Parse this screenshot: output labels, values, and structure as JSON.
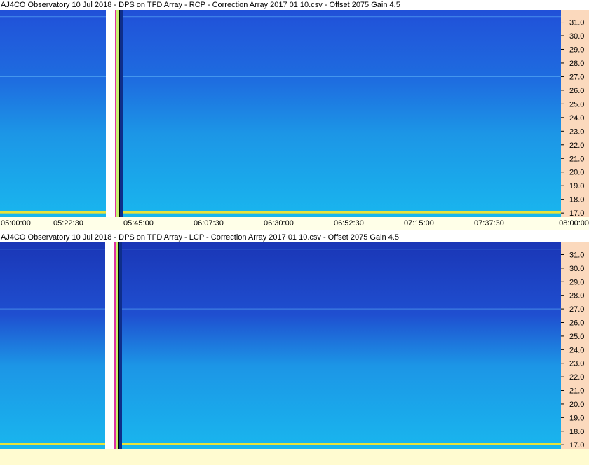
{
  "panels": [
    {
      "title": "AJ4CO Observatory 10 Jul 2018  -  DPS on TFD Array  -  RCP  -  Correction Array 2017 01 10.csv  -  Offset 2075  Gain 4.5"
    },
    {
      "title": "AJ4CO Observatory 10 Jul 2018  -  DPS on TFD Array  -  LCP  -  Correction Array 2017 01 10.csv  -  Offset 2075  Gain 4.5"
    }
  ],
  "colors": {
    "top_deep": "#1a3fd6",
    "bottom_cyan": "#19b6ee",
    "band_line": "#e8e23a",
    "axis_bg": "#ffffe8",
    "ylabel_bg": "#fbd9bd"
  },
  "chart_data": [
    {
      "type": "heatmap",
      "title": "AJ4CO Observatory 10 Jul 2018  -  DPS on TFD Array  -  RCP  -  Correction Array 2017 01 10.csv  -  Offset 2075  Gain 4.5",
      "x_ticks": [
        "05:00:00",
        "05:22:30",
        "05:45:00",
        "06:07:30",
        "06:30:00",
        "06:52:30",
        "07:15:00",
        "07:37:30",
        "08:00:00"
      ],
      "xlim": [
        "05:00:00",
        "08:00:00"
      ],
      "y_ticks": [
        31.0,
        30.0,
        29.0,
        28.0,
        27.0,
        26.0,
        25.0,
        24.0,
        23.0,
        22.0,
        21.0,
        20.0,
        19.0,
        18.0,
        17.0
      ],
      "ylim": [
        16.7,
        31.9
      ]
    },
    {
      "type": "heatmap",
      "title": "AJ4CO Observatory 10 Jul 2018  -  DPS on TFD Array  -  LCP  -  Correction Array 2017 01 10.csv  -  Offset 2075  Gain 4.5",
      "x_ticks": [],
      "xlim": [
        "05:00:00",
        "08:00:00"
      ],
      "y_ticks": [
        31.0,
        30.0,
        29.0,
        28.0,
        27.0,
        26.0,
        25.0,
        24.0,
        23.0,
        22.0,
        21.0,
        20.0,
        19.0,
        18.0,
        17.0
      ],
      "ylim": [
        16.7,
        31.9
      ]
    }
  ]
}
